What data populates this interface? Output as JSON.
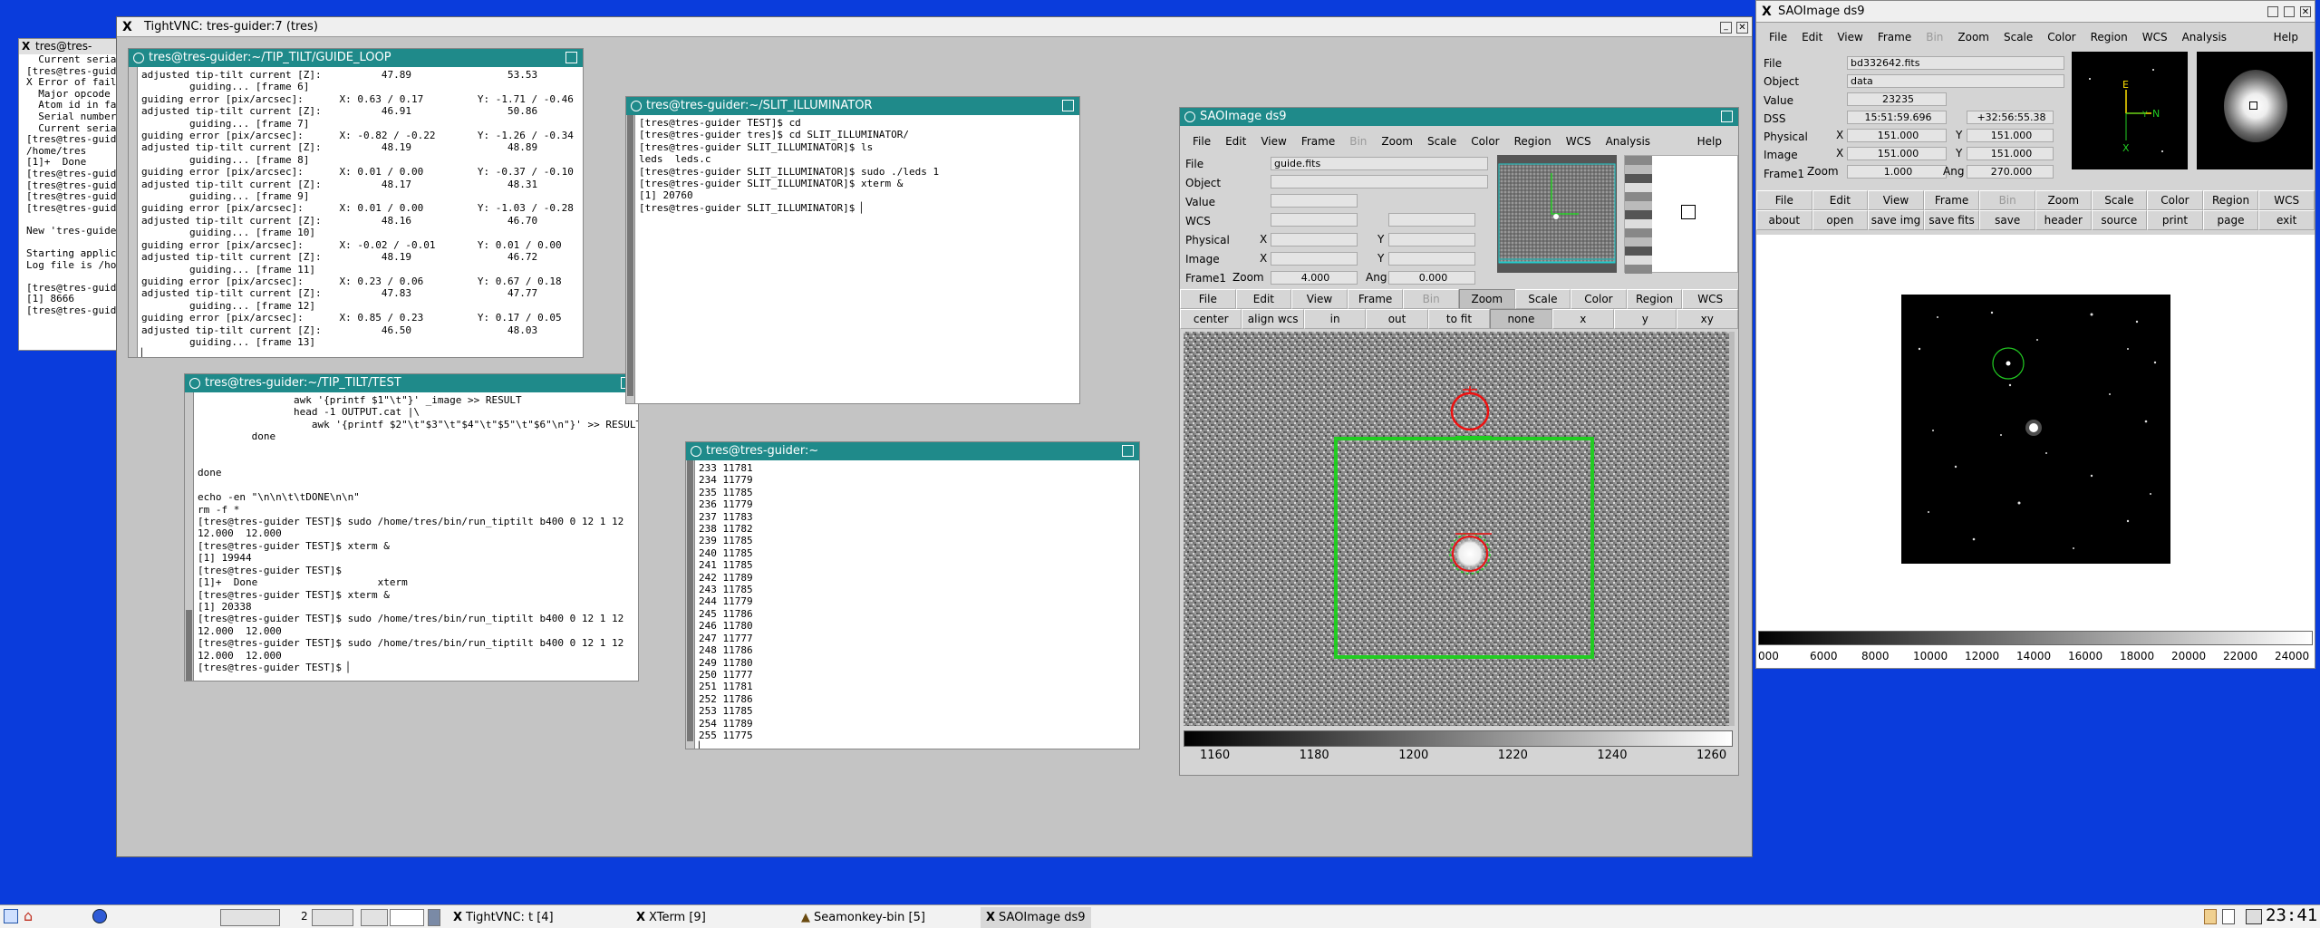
{
  "tightvnc": {
    "title": "TightVNC: tres-guider:7 (tres)"
  },
  "bg_term": {
    "title": "tres@tres-",
    "lines": [
      "  Current serial",
      "[tres@tres-guider",
      "X Error of failed",
      "  Major opcode of",
      "  Atom id in fail",
      "  Serial number c",
      "  Current serial",
      "[tres@tres-guider",
      "/home/tres",
      "[1]+  Done",
      "[tres@tres-guider",
      "[tres@tres-guider",
      "[tres@tres-guider",
      "[tres@tres-guider",
      "",
      "New 'tres-guider:",
      "",
      "Starting applicat",
      "Log file is /home",
      "",
      "[tres@tres-guider",
      "[1] 8666",
      "[tres@tres-guider"
    ]
  },
  "guide_loop": {
    "title": "tres@tres-guider:~/TIP_TILT/GUIDE_LOOP",
    "lines": [
      "adjusted tip-tilt current [Z]:          47.89                53.53",
      "        guiding... [frame 6]",
      "guiding error [pix/arcsec]:      X: 0.63 / 0.17         Y: -1.71 / -0.46",
      "adjusted tip-tilt current [Z]:          46.91                50.86",
      "        guiding... [frame 7]",
      "guiding error [pix/arcsec]:      X: -0.82 / -0.22       Y: -1.26 / -0.34",
      "adjusted tip-tilt current [Z]:          48.19                48.89",
      "        guiding... [frame 8]",
      "guiding error [pix/arcsec]:      X: 0.01 / 0.00         Y: -0.37 / -0.10",
      "adjusted tip-tilt current [Z]:          48.17                48.31",
      "        guiding... [frame 9]",
      "guiding error [pix/arcsec]:      X: 0.01 / 0.00         Y: -1.03 / -0.28",
      "adjusted tip-tilt current [Z]:          48.16                46.70",
      "        guiding... [frame 10]",
      "guiding error [pix/arcsec]:      X: -0.02 / -0.01       Y: 0.01 / 0.00",
      "adjusted tip-tilt current [Z]:          48.19                46.72",
      "        guiding... [frame 11]",
      "guiding error [pix/arcsec]:      X: 0.23 / 0.06         Y: 0.67 / 0.18",
      "adjusted tip-tilt current [Z]:          47.83                47.77",
      "        guiding... [frame 12]",
      "guiding error [pix/arcsec]:      X: 0.85 / 0.23         Y: 0.17 / 0.05",
      "adjusted tip-tilt current [Z]:          46.50                48.03",
      "        guiding... [frame 13]",
      "▏"
    ]
  },
  "slit": {
    "title": "tres@tres-guider:~/SLIT_ILLUMINATOR",
    "lines": [
      "[tres@tres-guider TEST]$ cd",
      "[tres@tres-guider tres]$ cd SLIT_ILLUMINATOR/",
      "[tres@tres-guider SLIT_ILLUMINATOR]$ ls",
      "leds  leds.c",
      "[tres@tres-guider SLIT_ILLUMINATOR]$ sudo ./leds 1",
      "[tres@tres-guider SLIT_ILLUMINATOR]$ xterm &",
      "[1] 20760",
      "[tres@tres-guider SLIT_ILLUMINATOR]$ ▏"
    ]
  },
  "tiptilt": {
    "title": "tres@tres-guider:~/TIP_TILT/TEST",
    "lines": [
      "                awk '{printf $1\"\\t\"}' _image >> RESULT",
      "                head -1 OUTPUT.cat |\\",
      "                   awk '{printf $2\"\\t\"$3\"\\t\"$4\"\\t\"$5\"\\t\"$6\"\\n\"}' >> RESULT",
      "         done",
      "",
      "",
      "done",
      "",
      "echo -en \"\\n\\n\\t\\tDONE\\n\\n\"",
      "rm -f *",
      "[tres@tres-guider TEST]$ sudo /home/tres/bin/run_tiptilt b400 0 12 1 12",
      "12.000  12.000",
      "[tres@tres-guider TEST]$ xterm &",
      "[1] 19944",
      "[tres@tres-guider TEST]$",
      "[1]+  Done                    xterm",
      "[tres@tres-guider TEST]$ xterm &",
      "[1] 20338",
      "[tres@tres-guider TEST]$ sudo /home/tres/bin/run_tiptilt b400 0 12 1 12",
      "12.000  12.000",
      "[tres@tres-guider TEST]$ sudo /home/tres/bin/run_tiptilt b400 0 12 1 12",
      "12.000  12.000",
      "[tres@tres-guider TEST]$ ▏"
    ]
  },
  "home_term": {
    "title": "tres@tres-guider:~",
    "lines": [
      "233 11781",
      "234 11779",
      "235 11785",
      "236 11779",
      "237 11783",
      "238 11782",
      "239 11785",
      "240 11785",
      "241 11785",
      "242 11789",
      "243 11785",
      "244 11779",
      "245 11786",
      "246 11780",
      "247 11777",
      "248 11786",
      "249 11780",
      "250 11777",
      "251 11781",
      "252 11786",
      "253 11785",
      "254 11789",
      "255 11775",
      "▏"
    ]
  },
  "ds9_inner": {
    "title": "SAOImage ds9",
    "menu": [
      "File",
      "Edit",
      "View",
      "Frame",
      "Bin",
      "Zoom",
      "Scale",
      "Color",
      "Region",
      "WCS",
      "Analysis"
    ],
    "help": "Help",
    "info": {
      "file_label": "File",
      "file": "guide.fits",
      "object_label": "Object",
      "value_label": "Value",
      "wcs_label": "WCS",
      "physical_label": "Physical",
      "image_label": "Image",
      "x": "X",
      "y": "Y",
      "frame_label": "Frame1",
      "zoom_label": "Zoom",
      "zoom": "4.000",
      "ang_label": "Ang",
      "ang": "0.000"
    },
    "btn1": [
      "File",
      "Edit",
      "View",
      "Frame",
      "Bin",
      "Zoom",
      "Scale",
      "Color",
      "Region",
      "WCS"
    ],
    "btn2": [
      "center",
      "align wcs",
      "in",
      "out",
      "to fit",
      "none",
      "x",
      "y",
      "xy"
    ],
    "colorbar": [
      "1160",
      "1180",
      "1200",
      "1220",
      "1240",
      "1260"
    ]
  },
  "ds9_outer": {
    "title": "SAOImage ds9",
    "menu": [
      "File",
      "Edit",
      "View",
      "Frame",
      "Bin",
      "Zoom",
      "Scale",
      "Color",
      "Region",
      "WCS",
      "Analysis"
    ],
    "help": "Help",
    "info": {
      "file_label": "File",
      "file": "bd332642.fits",
      "object_label": "Object",
      "object": "data",
      "value_label": "Value",
      "value": "23235",
      "dss_label": "DSS",
      "ra": "15:51:59.696",
      "dec": "+32:56:55.38",
      "physical_label": "Physical",
      "image_label": "Image",
      "x": "X",
      "y": "Y",
      "px": "151.000",
      "py": "151.000",
      "ix": "151.000",
      "iy": "151.000",
      "frame_label": "Frame1",
      "zoom_label": "Zoom",
      "zoom": "1.000",
      "ang_label": "Ang",
      "ang": "270.000"
    },
    "btn1": [
      "File",
      "Edit",
      "View",
      "Frame",
      "Bin",
      "Zoom",
      "Scale",
      "Color",
      "Region",
      "WCS"
    ],
    "btn2": [
      "about",
      "open",
      "save img",
      "save fits",
      "save mpeg",
      "header",
      "source",
      "print",
      "page",
      "exit"
    ],
    "colorbar": [
      "000",
      "6000",
      "8000",
      "10000",
      "12000",
      "14000",
      "16000",
      "18000",
      "20000",
      "22000",
      "24000"
    ],
    "compass": {
      "n": "N",
      "e": "E",
      "x": "X",
      "y": "Y"
    }
  },
  "taskbar": {
    "tasks": [
      "TightVNC: t [4]",
      "XTerm [9]",
      "Seamonkey-bin [5]",
      "SAOImage ds9"
    ],
    "clock": "23:41",
    "desk": "2"
  },
  "colors": {
    "desktop": "#0a3cdc",
    "xterm_title": "#1f8a8a",
    "region_green": "#22cc22",
    "region_red": "#ee1111"
  }
}
